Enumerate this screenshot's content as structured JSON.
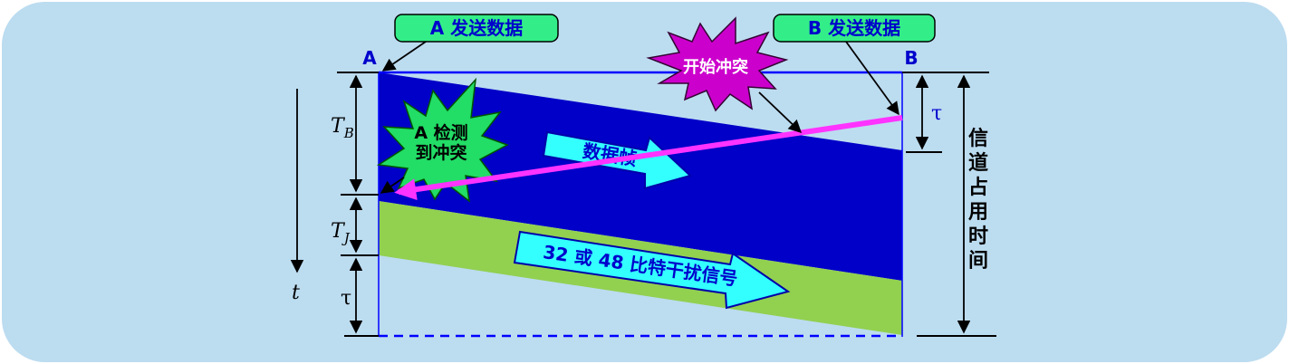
{
  "labels": {
    "node_a": "A",
    "node_b": "B",
    "a_sends": "A 发送数据",
    "b_sends": "B 发送数据",
    "collision_start": "开始冲突",
    "a_detects_line1": "A 检测",
    "a_detects_line2": "到冲突",
    "data_frame": "数据帧",
    "jam_signal": "32 或 48 比特干扰信号",
    "channel_time": [
      "信",
      "道",
      "占",
      "用",
      "时",
      "间"
    ],
    "tau": "τ",
    "tau_bottom": "τ",
    "time_axis": "t",
    "tb_main": "T",
    "tb_sub": "B",
    "tj_main": "T",
    "tj_sub": "J"
  },
  "colors": {
    "background_panel": "#bcdcf0",
    "data_region": "#0000c8",
    "jam_region": "#92d050",
    "callout_box": "#33ee88",
    "burst_magenta": "#cc00cc",
    "burst_green": "#22dd66",
    "arrow_cyan": "#33ffff",
    "signal_magenta": "#ff33ff",
    "blue_text": "#0000cc",
    "guide_line": "#0000ff"
  }
}
